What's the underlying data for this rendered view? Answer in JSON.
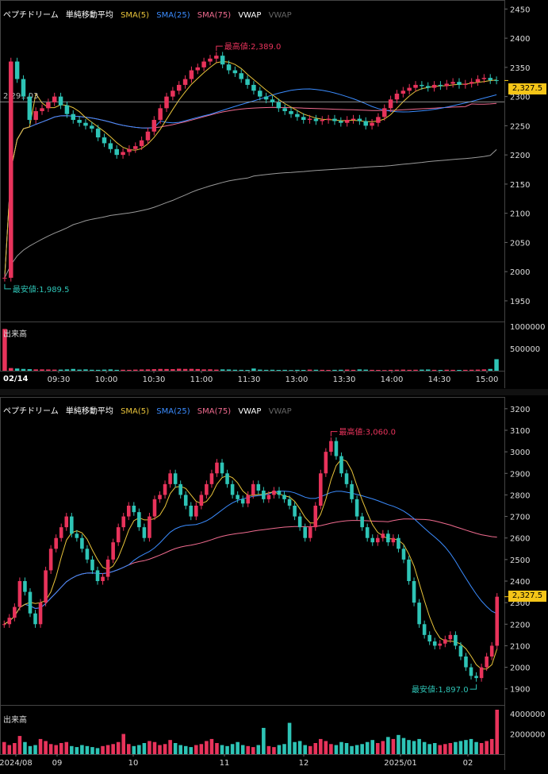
{
  "legend": {
    "name": "ペプチドリーム",
    "type": "単純移動平均",
    "sma5": "SMA(5)",
    "sma25": "SMA(25)",
    "sma75": "SMA(75)",
    "vwap": "VWAP",
    "vwap2": "VWAP"
  },
  "colors": {
    "up": "#e8335b",
    "down": "#2ec4b6",
    "sma5": "#e8c33a",
    "sma25": "#3b8cff",
    "sma75": "#f06b8f",
    "vwap": "#9a9a9a",
    "price_tag": "#f5c518",
    "high_label": "#e8335b",
    "low_label": "#2ec4b6"
  },
  "volume_label": "出来高",
  "current_price_label": "2,327.5",
  "chart_data": [
    {
      "type": "candlestick",
      "title": "ペプチドリーム intraday",
      "date_label": "02/14",
      "ylim": [
        1920,
        2460
      ],
      "y_ticks": [
        "2450",
        "2400",
        "2350",
        "2300",
        "2250",
        "2200",
        "2150",
        "2100",
        "2050",
        "2000",
        "1950"
      ],
      "x_ticks": [
        "09:30",
        "10:00",
        "10:30",
        "11:00",
        "11:30",
        "13:00",
        "13:30",
        "14:00",
        "14:30",
        "15:00"
      ],
      "high_annotation": "最高値:2,389.0",
      "low_annotation": "最安値:1,989.5",
      "vwap_label": "2,291.03",
      "current_price": 2327.5,
      "volume_ticks": [
        "1000000",
        "500000"
      ],
      "volume_max": 1000000,
      "close_series": [
        1989.5,
        2360,
        2330,
        2300,
        2260,
        2275,
        2280,
        2290,
        2300,
        2285,
        2270,
        2260,
        2255,
        2250,
        2245,
        2230,
        2220,
        2210,
        2200,
        2205,
        2210,
        2215,
        2225,
        2240,
        2260,
        2280,
        2300,
        2310,
        2320,
        2330,
        2345,
        2350,
        2360,
        2365,
        2370,
        2355,
        2345,
        2340,
        2330,
        2320,
        2310,
        2300,
        2295,
        2290,
        2280,
        2275,
        2270,
        2265,
        2260,
        2262,
        2258,
        2260,
        2262,
        2258,
        2255,
        2260,
        2262,
        2258,
        2250,
        2255,
        2265,
        2280,
        2295,
        2305,
        2310,
        2315,
        2320,
        2318,
        2315,
        2320,
        2318,
        2322,
        2325,
        2320,
        2322,
        2325,
        2330,
        2332,
        2328,
        2327.5
      ],
      "volume_series": [
        940000,
        60000,
        50000,
        40000,
        35000,
        30000,
        30000,
        28000,
        25000,
        25000,
        30000,
        40000,
        25000,
        30000,
        22000,
        20000,
        25000,
        30000,
        20000,
        22000,
        20000,
        25000,
        28000,
        30000,
        35000,
        40000,
        38000,
        35000,
        45000,
        40000,
        42000,
        38000,
        30000,
        32000,
        25000,
        30000,
        28000,
        22000,
        20000,
        18000,
        50000,
        25000,
        20000,
        22000,
        18000,
        20000,
        15000,
        20000,
        18000,
        25000,
        22000,
        20000,
        18000,
        20000,
        22000,
        25000,
        20000,
        30000,
        25000,
        20000,
        18000,
        15000,
        20000,
        22000,
        25000,
        20000,
        22000,
        25000,
        28000,
        20000,
        18000,
        22000,
        20000,
        18000,
        20000,
        22000,
        25000,
        30000,
        40000,
        260000
      ]
    },
    {
      "type": "candlestick",
      "title": "ペプチドリーム daily",
      "ylim": [
        1840,
        3240
      ],
      "y_ticks": [
        "3200",
        "3100",
        "3000",
        "2900",
        "2800",
        "2700",
        "2600",
        "2500",
        "2400",
        "2300",
        "2200",
        "2100",
        "2000",
        "1900"
      ],
      "x_ticks": [
        "2024/08",
        "09",
        "10",
        "11",
        "12",
        "2025/01",
        "02"
      ],
      "high_annotation": "最高値:3,060.0",
      "low_annotation": "最安値:1,897.0",
      "current_price": 2327.5,
      "volume_ticks": [
        "4000000",
        "2000000"
      ],
      "volume_max": 4400000,
      "close_series": [
        2200,
        2230,
        2280,
        2400,
        2350,
        2250,
        2200,
        2300,
        2450,
        2550,
        2600,
        2650,
        2700,
        2620,
        2600,
        2550,
        2500,
        2450,
        2400,
        2420,
        2500,
        2580,
        2650,
        2700,
        2750,
        2720,
        2650,
        2600,
        2700,
        2780,
        2800,
        2850,
        2900,
        2850,
        2800,
        2750,
        2700,
        2750,
        2800,
        2850,
        2900,
        2950,
        2900,
        2850,
        2800,
        2780,
        2760,
        2800,
        2850,
        2820,
        2780,
        2800,
        2820,
        2800,
        2780,
        2750,
        2700,
        2650,
        2600,
        2650,
        2750,
        2900,
        3000,
        3050,
        2980,
        2900,
        2850,
        2780,
        2700,
        2650,
        2600,
        2580,
        2600,
        2620,
        2580,
        2600,
        2550,
        2500,
        2400,
        2300,
        2200,
        2150,
        2120,
        2100,
        2110,
        2130,
        2150,
        2100,
        2050,
        2000,
        1960,
        1950,
        2000,
        2050,
        2100,
        2327.5
      ],
      "volume_series": [
        1200000,
        900000,
        1100000,
        1800000,
        1200000,
        800000,
        900000,
        1500000,
        1300000,
        1000000,
        900000,
        1100000,
        1200000,
        800000,
        700000,
        900000,
        800000,
        700000,
        600000,
        800000,
        900000,
        1000000,
        1200000,
        2000000,
        1000000,
        800000,
        900000,
        1100000,
        1300000,
        1200000,
        900000,
        1000000,
        1400000,
        1100000,
        900000,
        800000,
        700000,
        900000,
        1000000,
        1300000,
        1500000,
        1100000,
        900000,
        800000,
        1000000,
        1200000,
        900000,
        800000,
        700000,
        900000,
        2600000,
        800000,
        700000,
        900000,
        1000000,
        3100000,
        1200000,
        1300000,
        900000,
        800000,
        1100000,
        1500000,
        1300000,
        1000000,
        900000,
        1200000,
        1100000,
        800000,
        900000,
        1000000,
        1200000,
        1400000,
        1100000,
        1300000,
        1700000,
        1500000,
        1900000,
        1600000,
        1400000,
        1300000,
        1500000,
        1200000,
        1000000,
        1100000,
        900000,
        1000000,
        1100000,
        1200000,
        1300000,
        1400000,
        1500000,
        1200000,
        1100000,
        1300000,
        1500000,
        4400000
      ]
    }
  ]
}
